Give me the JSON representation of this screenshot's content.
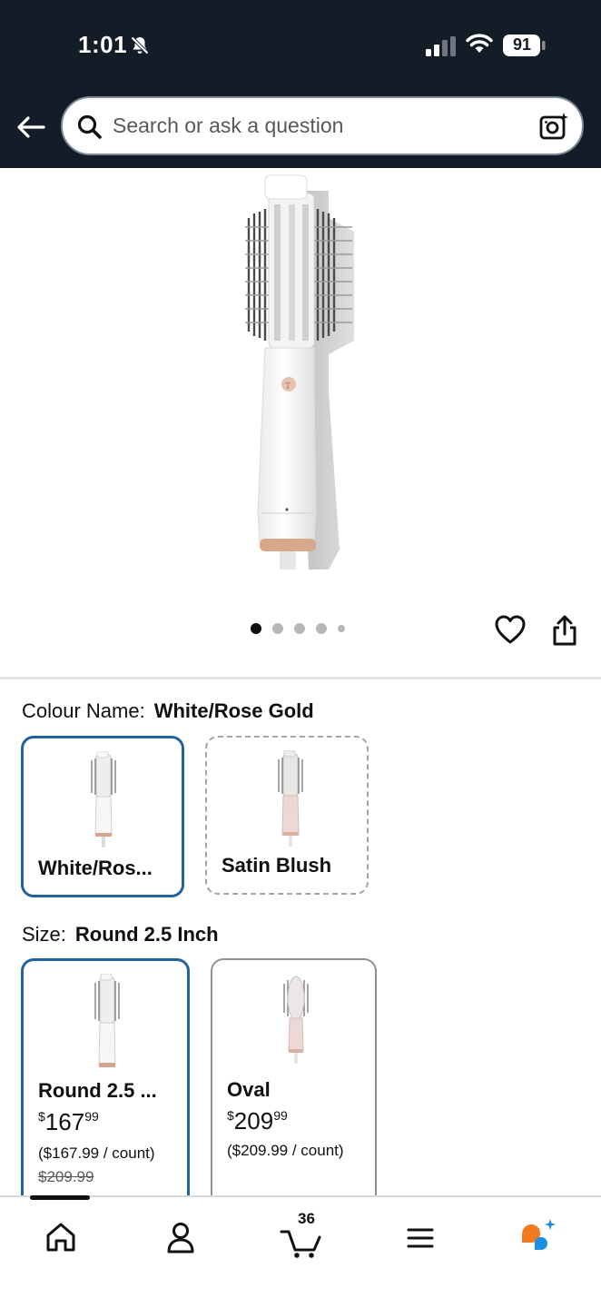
{
  "status_bar": {
    "time": "1:01",
    "battery": "91"
  },
  "header": {
    "search_placeholder": "Search or ask a question"
  },
  "gallery": {
    "image_count": 5,
    "active_index": 0
  },
  "colour": {
    "label": "Colour Name:",
    "selected": "White/Rose Gold",
    "options": [
      {
        "name": "White/Ros..."
      },
      {
        "name": "Satin Blush"
      }
    ]
  },
  "size": {
    "label": "Size:",
    "selected": "Round 2.5 Inch",
    "options": [
      {
        "name": "Round 2.5 ...",
        "price_currency": "$",
        "price_whole": "167",
        "price_fraction": "99",
        "unit_price": "($167.99 / count)",
        "list_price": "$209.99"
      },
      {
        "name": "Oval",
        "price_currency": "$",
        "price_whole": "209",
        "price_fraction": "99",
        "unit_price": "($209.99 / count)"
      }
    ]
  },
  "bottom_nav": {
    "cart_count": "36"
  },
  "colors": {
    "header_bg": "#141c27",
    "selected_border": "#2162a1",
    "rufus_orange": "#f47a20",
    "rufus_blue": "#1c8ee6"
  }
}
